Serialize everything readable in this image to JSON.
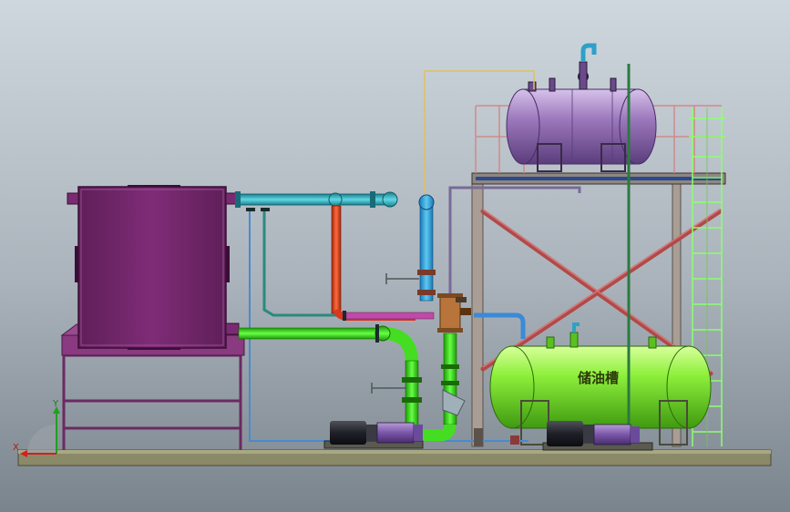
{
  "storage_tank": {
    "label": "储油槽"
  },
  "axis_triad": {
    "x_label": "X",
    "y_label": "Y"
  },
  "colors": {
    "background_top": "#c7d0d8",
    "background_bottom": "#7e8890",
    "furnace": "#7a2a72",
    "expansion_tank": "#9a76b8",
    "storage_tank": "#8cf03a",
    "frame": "#9a8f88",
    "cyan_pipe": "#2fb0c0",
    "red_pipe": "#e04020",
    "green_pipe": "#40e020",
    "blue_pipe": "#5aa0e0",
    "gold_line": "#e0c060",
    "ladder": "#90ff80",
    "cross_brace": "#b04a4a",
    "base_skid": "#8a8a6a"
  }
}
